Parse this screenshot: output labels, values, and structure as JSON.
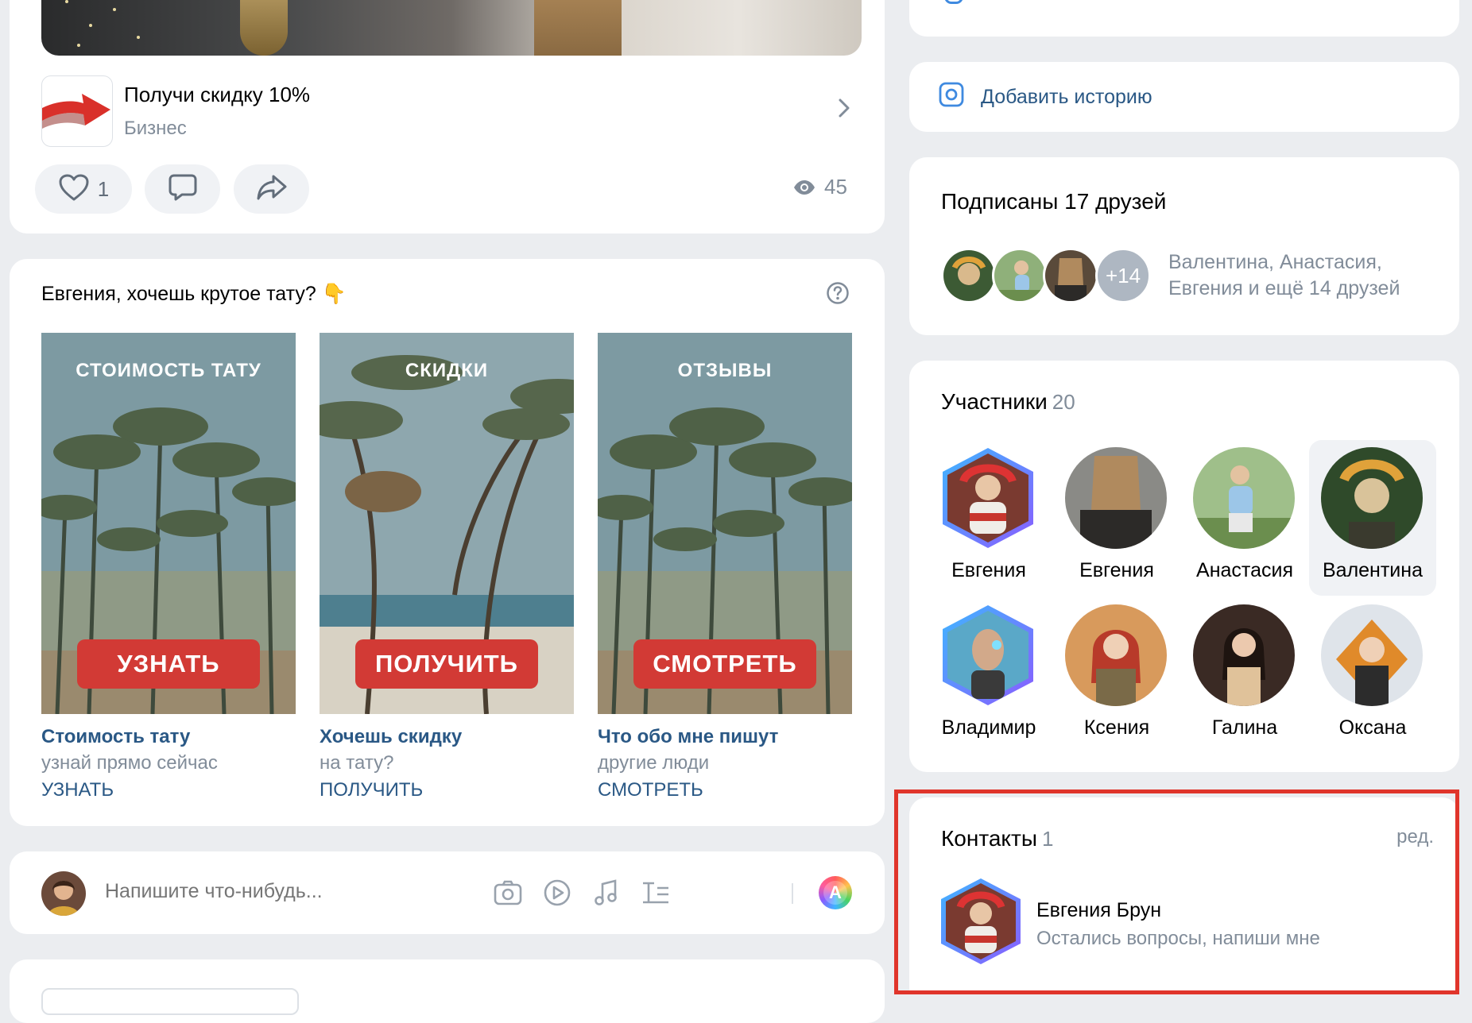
{
  "post": {
    "link_title": "Получи скидку 10%",
    "link_subtitle": "Бизнес",
    "likes": "1",
    "views": "45"
  },
  "ad": {
    "title": "Евгения, хочешь крутое тату? 👇",
    "tiles": [
      {
        "heading": "СТОИМОСТЬ ТАТУ",
        "button": "УЗНАТЬ",
        "caption_title": "Стоимость тату",
        "caption_sub": "узнай прямо сейчас",
        "caption_link": "УЗНАТЬ"
      },
      {
        "heading": "СКИДКИ",
        "button": "ПОЛУЧИТЬ",
        "caption_title": "Хочешь скидку",
        "caption_sub": "на тату?",
        "caption_link": "ПОЛУЧИТЬ"
      },
      {
        "heading": "ОТЗЫВЫ",
        "button": "СМОТРЕТЬ",
        "caption_title": "Что обо мне пишут",
        "caption_sub": "другие люди",
        "caption_link": "СМОТРЕТЬ"
      }
    ]
  },
  "composer": {
    "placeholder": "Напишите что-нибудь...",
    "style_letter": "A"
  },
  "story": {
    "label": "Добавить историю"
  },
  "subscribers": {
    "title": "Подписаны 17 друзей",
    "more": "+14",
    "names_line1": "Валентина, Анастасия,",
    "names_line2": "Евгения и ещё 14 друзей"
  },
  "members": {
    "title": "Участники",
    "count": "20",
    "list": [
      {
        "name": "Евгения"
      },
      {
        "name": "Евгения"
      },
      {
        "name": "Анастасия"
      },
      {
        "name": "Валентина"
      },
      {
        "name": "Владимир"
      },
      {
        "name": "Ксения"
      },
      {
        "name": "Галина"
      },
      {
        "name": "Оксана"
      }
    ]
  },
  "contacts": {
    "title": "Контакты",
    "count": "1",
    "edit": "ред.",
    "name": "Евгения Брун",
    "subtitle": "Остались вопросы, напиши мне"
  },
  "colors": {
    "accent_link": "#2a5885",
    "cta_red": "#d23a35",
    "highlight": "#e0352b",
    "background": "#ebedf0"
  }
}
